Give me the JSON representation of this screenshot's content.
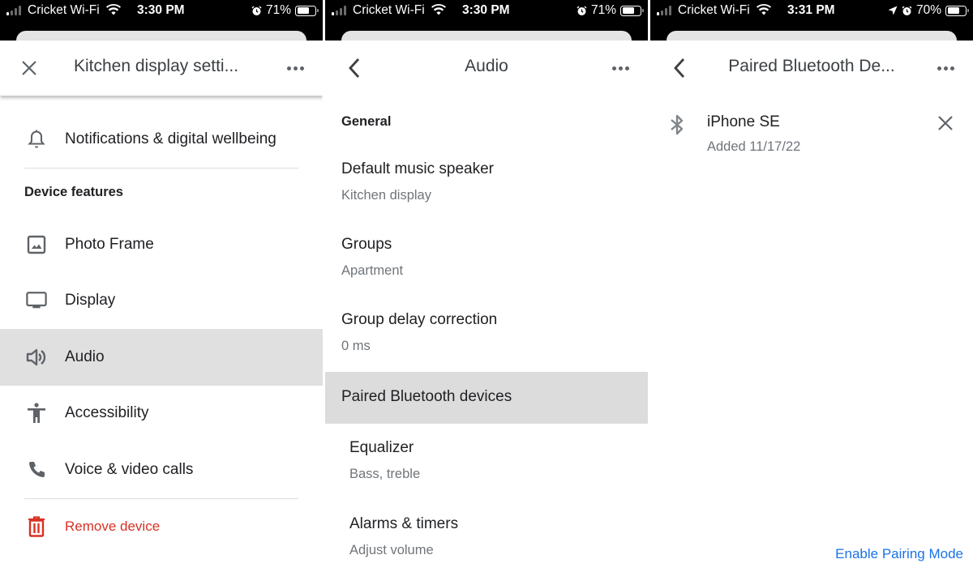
{
  "panels": [
    {
      "status": {
        "carrier": "Cricket Wi-Fi",
        "time": "3:30 PM",
        "battery": "71%",
        "battery_level": 0.71,
        "icons": [
          "signal-icon",
          "wifi-icon",
          "alarm-icon",
          "battery-icon"
        ]
      },
      "header": {
        "title": "Kitchen display setti...",
        "lead_icon": "close-icon",
        "more_icon": "more-horizontal-icon"
      },
      "items_top": [
        {
          "label": "Notifications & digital wellbeing",
          "icon": "bell-icon"
        }
      ],
      "section": "Device features",
      "features": [
        {
          "label": "Photo Frame",
          "icon": "photo-icon"
        },
        {
          "label": "Display",
          "icon": "monitor-icon"
        },
        {
          "label": "Audio",
          "icon": "speaker-icon",
          "selected": true
        },
        {
          "label": "Accessibility",
          "icon": "accessibility-icon"
        },
        {
          "label": "Voice & video calls",
          "icon": "phone-icon"
        }
      ],
      "danger": {
        "label": "Remove device",
        "icon": "trash-icon",
        "color": "#d93025"
      }
    },
    {
      "status": {
        "carrier": "Cricket Wi-Fi",
        "time": "3:30 PM",
        "battery": "71%",
        "battery_level": 0.71
      },
      "header": {
        "title": "Audio",
        "lead_icon": "back-chevron-icon",
        "more_icon": "more-horizontal-icon"
      },
      "section": "General",
      "rows": [
        {
          "title": "Default music speaker",
          "subtitle": "Kitchen display"
        },
        {
          "title": "Groups",
          "subtitle": "Apartment"
        },
        {
          "title": "Group delay correction",
          "subtitle": "0 ms"
        },
        {
          "title": "Paired Bluetooth devices",
          "selected": true
        },
        {
          "title": "Equalizer",
          "subtitle": "Bass, treble"
        },
        {
          "title": "Alarms & timers",
          "subtitle": "Adjust volume"
        }
      ]
    },
    {
      "status": {
        "carrier": "Cricket Wi-Fi",
        "time": "3:31 PM",
        "battery": "70%",
        "battery_level": 0.7
      },
      "header": {
        "title": "Paired Bluetooth De...",
        "lead_icon": "back-chevron-icon",
        "more_icon": "more-horizontal-icon"
      },
      "devices": [
        {
          "name": "iPhone SE",
          "added": "Added 11/17/22",
          "icon": "bluetooth-icon"
        }
      ],
      "action": {
        "label": "Enable Pairing Mode",
        "color": "#1a73e8"
      }
    }
  ]
}
